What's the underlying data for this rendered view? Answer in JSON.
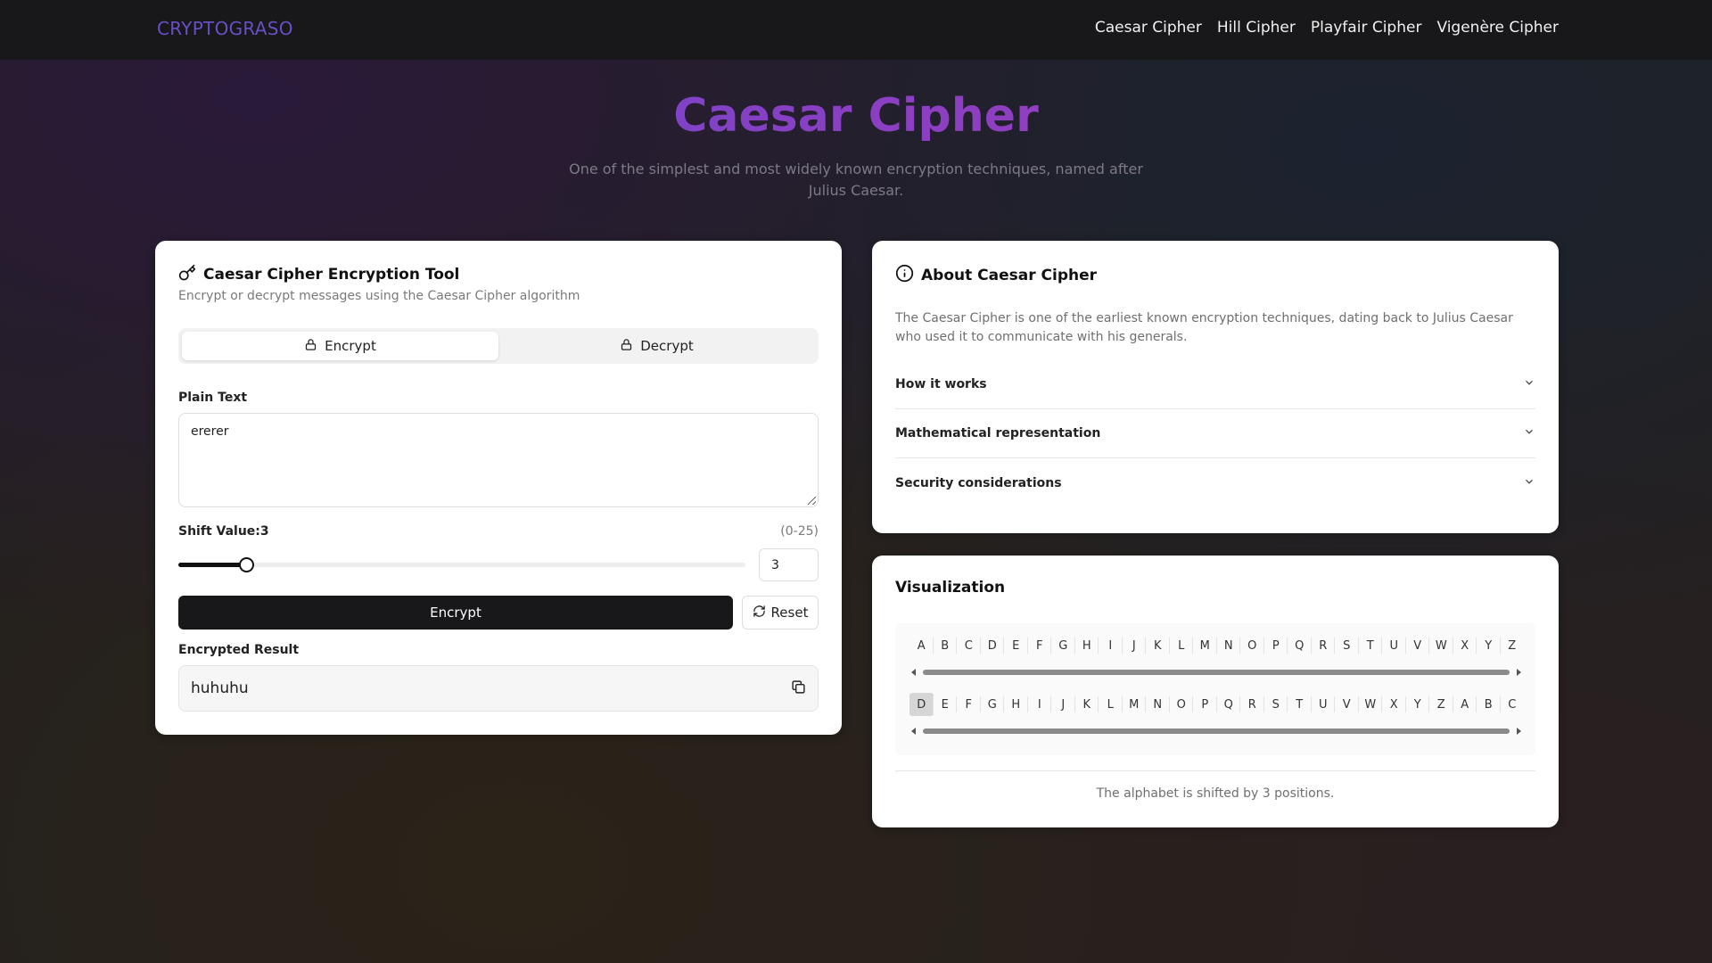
{
  "nav": {
    "brand": "CRYPTOGRASO",
    "links": [
      "Caesar Cipher",
      "Hill Cipher",
      "Playfair Cipher",
      "Vigenère Cipher"
    ]
  },
  "hero": {
    "title": "Caesar Cipher",
    "subtitle": "One of the simplest and most widely known encryption techniques, named after Julius Caesar."
  },
  "tool": {
    "title": "Caesar Cipher Encryption Tool",
    "description": "Encrypt or decrypt messages using the Caesar Cipher algorithm",
    "tabs": [
      {
        "label": "Encrypt",
        "icon": "lock-icon",
        "active": true
      },
      {
        "label": "Decrypt",
        "icon": "lock-icon",
        "active": false
      }
    ],
    "input_label": "Plain Text",
    "input_value": "ererer",
    "shift_label": "Shift Value:",
    "shift_value": "3",
    "shift_range": "(0-25)",
    "shift_fraction": 0.12,
    "encrypt_button": "Encrypt",
    "reset_button": "Reset",
    "result_label": "Encrypted Result",
    "result_value": "huhuhu"
  },
  "about": {
    "title": "About Caesar Cipher",
    "text": "The Caesar Cipher is one of the earliest known encryption techniques, dating back to Julius Caesar who used it to communicate with his generals.",
    "sections": [
      "How it works",
      "Mathematical representation",
      "Security considerations"
    ]
  },
  "viz": {
    "title": "Visualization",
    "plain_alphabet": [
      "A",
      "B",
      "C",
      "D",
      "E",
      "F",
      "G",
      "H",
      "I",
      "J",
      "K",
      "L",
      "M",
      "N",
      "O",
      "P",
      "Q",
      "R",
      "S",
      "T",
      "U",
      "V",
      "W",
      "X",
      "Y",
      "Z"
    ],
    "shifted_alphabet": [
      "D",
      "E",
      "F",
      "G",
      "H",
      "I",
      "J",
      "K",
      "L",
      "M",
      "N",
      "O",
      "P",
      "Q",
      "R",
      "S",
      "T",
      "U",
      "V",
      "W",
      "X",
      "Y",
      "Z",
      "A",
      "B",
      "C"
    ],
    "caption": "The alphabet is shifted by 3 positions."
  },
  "colors": {
    "brand": "#6a4fc4",
    "title_gradient_start": "#5b4fd4",
    "title_gradient_end": "#a33fb8",
    "primary_button": "#18181b"
  }
}
